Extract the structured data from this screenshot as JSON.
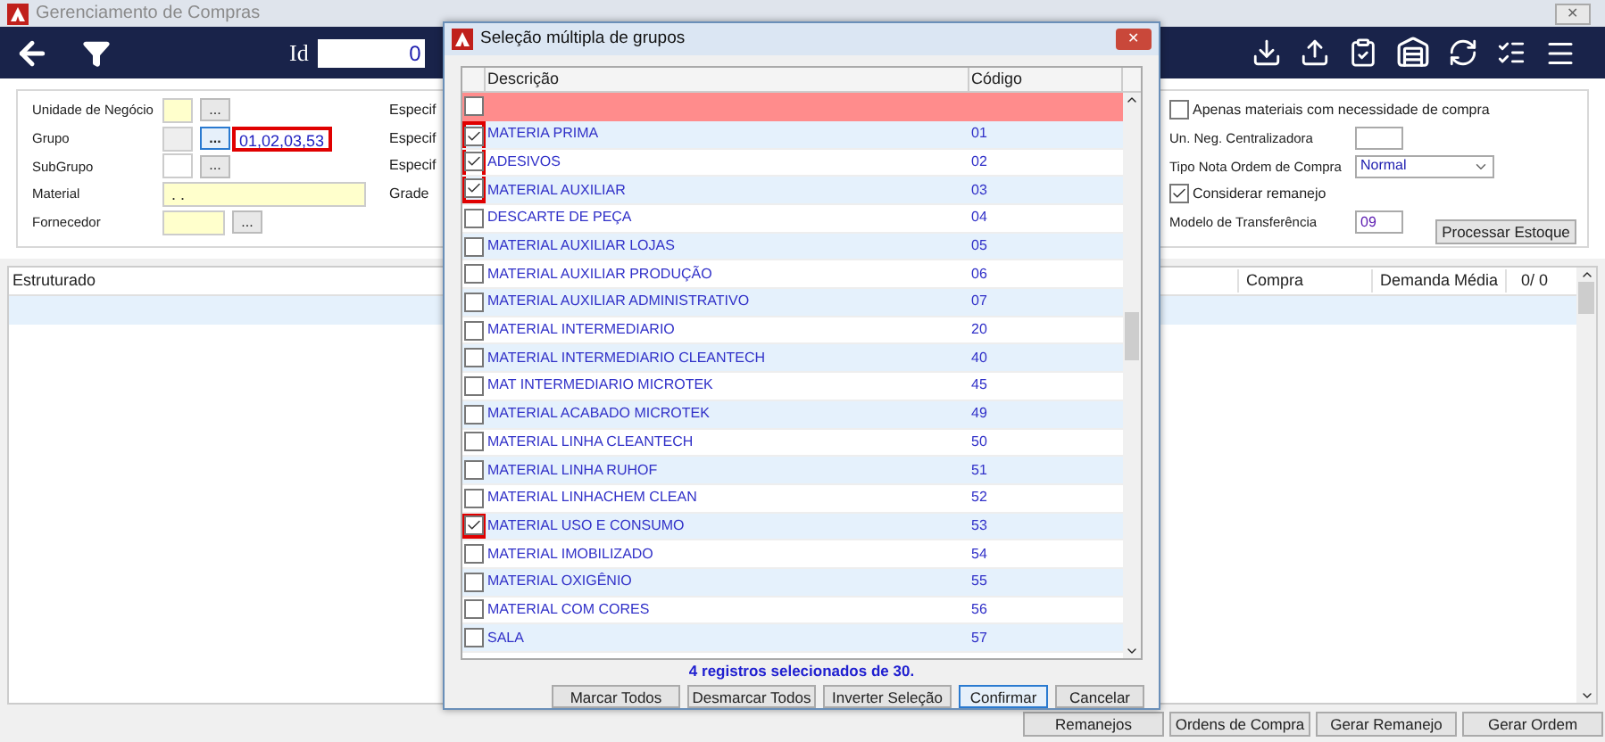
{
  "window": {
    "title": "Gerenciamento de Compras",
    "close": "✕"
  },
  "toolbar": {
    "id_label": "Id",
    "id_value": "0"
  },
  "filters_left": [
    {
      "label": "Unidade de Negócio",
      "kind": "lookup",
      "required": true,
      "button": "...",
      "focused": false
    },
    {
      "label": "Grupo",
      "kind": "lookup",
      "required": false,
      "disabled": true,
      "button": "...",
      "focused": true,
      "value": "01,02,03,53",
      "highlighted": true
    },
    {
      "label": "SubGrupo",
      "kind": "lookup",
      "required": false,
      "disabled": false,
      "button": "...",
      "focused": false
    },
    {
      "label": "Material",
      "kind": "text",
      "required": true,
      "value": ". ."
    },
    {
      "label": "Fornecedor",
      "kind": "wide_lookup",
      "required": true,
      "button": "...",
      "focused": false
    }
  ],
  "filters_middle": [
    "Especif",
    "Especif",
    "Especif",
    "Grade"
  ],
  "options": [
    {
      "kind": "checkbox",
      "label": "Apenas materiais com necessidade de compra",
      "checked": false
    },
    {
      "kind": "input",
      "label": "Un. Neg. Centralizadora"
    },
    {
      "kind": "select",
      "label": "Tipo Nota Ordem de Compra",
      "value": "Normal"
    },
    {
      "kind": "checkbox",
      "label": "Considerar remanejo",
      "checked": true
    },
    {
      "kind": "input",
      "label": "Modelo de Transferência",
      "value": "09"
    }
  ],
  "process_button": "Processar Estoque",
  "grid": {
    "columns_left": [
      "Estruturado"
    ],
    "columns_right": [
      "Compra",
      "Demanda Média"
    ],
    "count": "0/ 0"
  },
  "bottom_buttons": [
    "Remanejos",
    "Ordens de Compra",
    "Gerar Remanejo",
    "Gerar Ordem"
  ],
  "dialog": {
    "title": "Seleção múltipla de grupos",
    "close": "✕",
    "columns": [
      "Descrição",
      "Código"
    ],
    "select_all_checked": false,
    "rows": [
      {
        "description": "MATERIA PRIMA",
        "code": "01",
        "checked": true,
        "highlighted": true
      },
      {
        "description": "ADESIVOS",
        "code": "02",
        "checked": true,
        "highlighted": true
      },
      {
        "description": "MATERIAL AUXILIAR",
        "code": "03",
        "checked": true,
        "highlighted": true
      },
      {
        "description": "DESCARTE DE PEÇA",
        "code": "04",
        "checked": false,
        "highlighted": false
      },
      {
        "description": "MATERIAL AUXILIAR LOJAS",
        "code": "05",
        "checked": false,
        "highlighted": false
      },
      {
        "description": "MATERIAL AUXILIAR PRODUÇÃO",
        "code": "06",
        "checked": false,
        "highlighted": false
      },
      {
        "description": "MATERIAL AUXILIAR ADMINISTRATIVO",
        "code": "07",
        "checked": false,
        "highlighted": false
      },
      {
        "description": "MATERIAL INTERMEDIARIO",
        "code": "20",
        "checked": false,
        "highlighted": false
      },
      {
        "description": "MATERIAL INTERMEDIARIO CLEANTECH",
        "code": "40",
        "checked": false,
        "highlighted": false
      },
      {
        "description": "MAT INTERMEDIARIO MICROTEK",
        "code": "45",
        "checked": false,
        "highlighted": false
      },
      {
        "description": "MATERIAL ACABADO MICROTEK",
        "code": "49",
        "checked": false,
        "highlighted": false
      },
      {
        "description": "MATERIAL LINHA CLEANTECH",
        "code": "50",
        "checked": false,
        "highlighted": false
      },
      {
        "description": "MATERIAL LINHA RUHOF",
        "code": "51",
        "checked": false,
        "highlighted": false
      },
      {
        "description": "MATERIAL LINHACHEM CLEAN",
        "code": "52",
        "checked": false,
        "highlighted": false
      },
      {
        "description": "MATERIAL USO E CONSUMO",
        "code": "53",
        "checked": true,
        "highlighted": true
      },
      {
        "description": "MATERIAL IMOBILIZADO",
        "code": "54",
        "checked": false,
        "highlighted": false
      },
      {
        "description": "MATERIAL OXIGÊNIO",
        "code": "55",
        "checked": false,
        "highlighted": false
      },
      {
        "description": "MATERIAL COM CORES",
        "code": "56",
        "checked": false,
        "highlighted": false
      },
      {
        "description": "SALA",
        "code": "57",
        "checked": false,
        "highlighted": false
      }
    ],
    "status": "4 registros selecionados de 30.",
    "buttons": [
      {
        "label": "Marcar Todos",
        "default": false
      },
      {
        "label": "Desmarcar Todos",
        "default": false
      },
      {
        "label": "Inverter Seleção",
        "default": false
      },
      {
        "label": "Confirmar",
        "default": true
      },
      {
        "label": "Cancelar",
        "default": false
      }
    ]
  }
}
